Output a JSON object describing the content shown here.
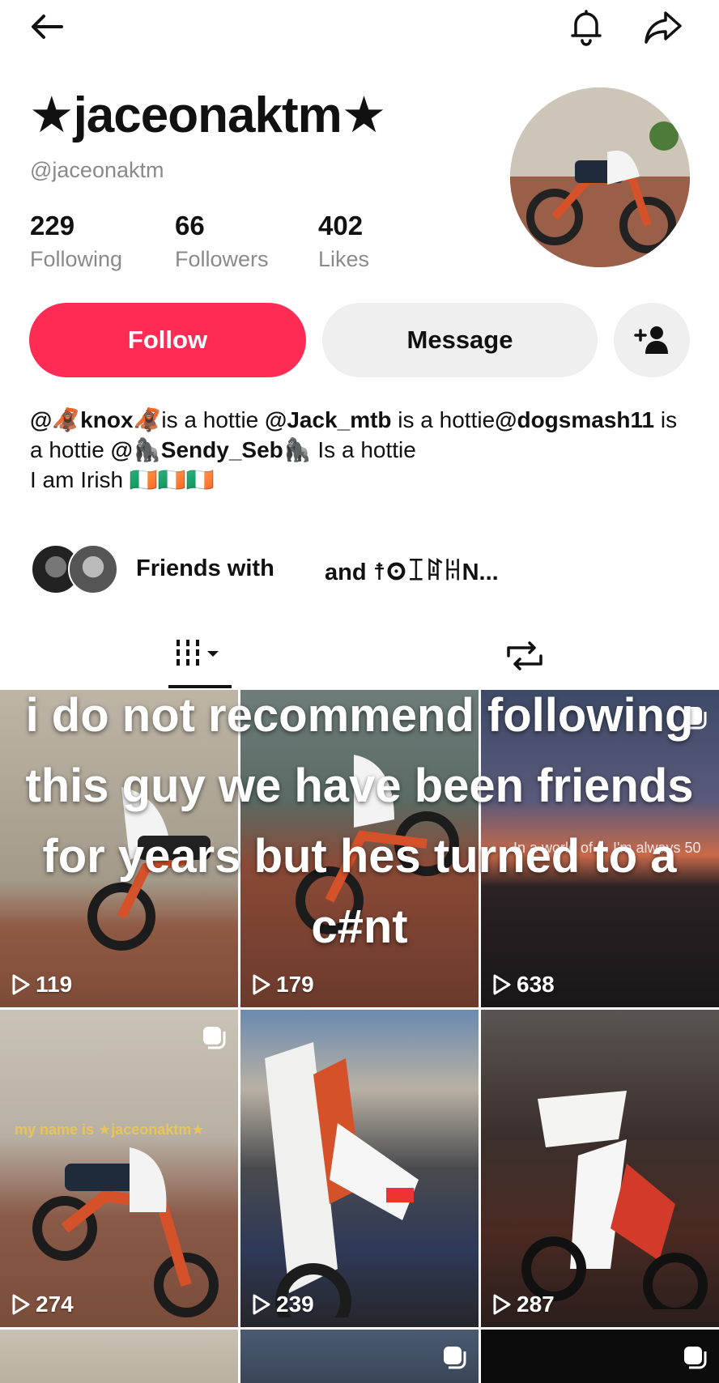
{
  "header": {
    "back_icon": "arrow-left-icon",
    "bell_icon": "bell-icon",
    "share_icon": "share-arrow-icon"
  },
  "profile": {
    "display_name": "★jaceonaktm★",
    "username": "@jaceonaktm",
    "stats": [
      {
        "value": "229",
        "label": "Following"
      },
      {
        "value": "66",
        "label": "Followers"
      },
      {
        "value": "402",
        "label": "Likes"
      }
    ],
    "follow_label": "Follow",
    "message_label": "Message",
    "add_friend_icon": "person-plus-icon",
    "bio": {
      "m1": "@🦧knox🦧",
      "t1": "is a hottie ",
      "m2": "@Jack_mtb",
      "t2": " is a hottie",
      "m3": "@dogsmash11",
      "t3": " is a hottie ",
      "m4": "@🦍Sendy_Seb🦍",
      "t4": " Is a hottie",
      "line2": "I am Irish 🇮🇪🇮🇪🇮🇪"
    },
    "friends_text": "Friends with",
    "friends_and": "and ☨𐌏ꀤꍏꀍN...",
    "accent_color": "#fe2c55"
  },
  "tabs": {
    "videos_icon": "grid-videos-icon",
    "reposts_icon": "repost-icon"
  },
  "grid": [
    {
      "views": "119"
    },
    {
      "views": "179"
    },
    {
      "views": "638"
    },
    {
      "views": "274"
    },
    {
      "views": "239"
    },
    {
      "views": "287"
    }
  ],
  "overlay": {
    "caption": "i do not recommend following this guy we have been friends for years but hes turned to a c#nt",
    "cell3_text": "In a world of ... I'm always 50",
    "cell4_text": "my name is ★jaceonaktm★"
  }
}
